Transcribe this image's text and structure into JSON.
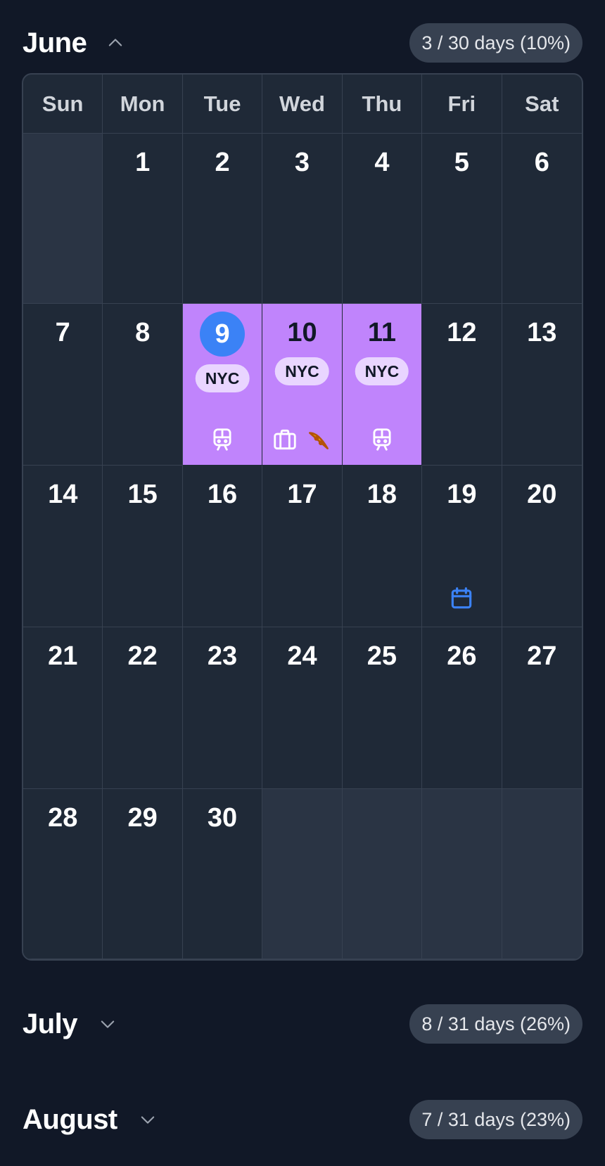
{
  "months": [
    {
      "name": "June",
      "stat": "3 / 30 days (10%)",
      "expanded": true,
      "chevron": "chevron-up-icon"
    },
    {
      "name": "July",
      "stat": "8 / 31 days (26%)",
      "expanded": false,
      "chevron": "chevron-down-icon"
    },
    {
      "name": "August",
      "stat": "7 / 31 days (23%)",
      "expanded": false,
      "chevron": "chevron-down-icon"
    }
  ],
  "weekdays": [
    "Sun",
    "Mon",
    "Tue",
    "Wed",
    "Thu",
    "Fri",
    "Sat"
  ],
  "june": {
    "leading_empty": 1,
    "trailing_empty": 4,
    "today": "9",
    "days": [
      "1",
      "2",
      "3",
      "4",
      "5",
      "6",
      "7",
      "8",
      "9",
      "10",
      "11",
      "12",
      "13",
      "14",
      "15",
      "16",
      "17",
      "18",
      "19",
      "20",
      "21",
      "22",
      "23",
      "24",
      "25",
      "26",
      "27",
      "28",
      "29",
      "30"
    ],
    "trips": {
      "9": {
        "tag": "NYC",
        "icons": [
          "train-icon"
        ]
      },
      "10": {
        "tag": "NYC",
        "icons": [
          "luggage-icon",
          "pizza-icon"
        ]
      },
      "11": {
        "tag": "NYC",
        "icons": [
          "train-icon"
        ]
      }
    },
    "events": {
      "19": {
        "icons": [
          "calendar-icon"
        ]
      }
    }
  },
  "colors": {
    "background": "#111827",
    "cell": "#1f2937",
    "empty_cell": "#2a3444",
    "trip": "#c084fc",
    "tag": "#e9d5ff",
    "today": "#3b82f6",
    "pill": "#374151",
    "pizza": "#eab308",
    "calendar_icon": "#3b82f6"
  }
}
